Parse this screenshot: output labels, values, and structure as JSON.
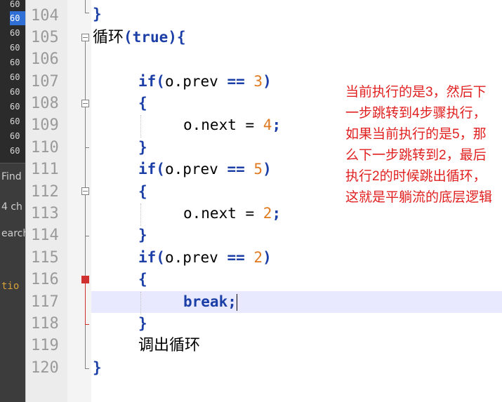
{
  "sidebar": {
    "numbers": [
      "60",
      "60",
      "60",
      "60",
      "60",
      "60",
      "60",
      "60",
      "60",
      "60",
      "60"
    ],
    "find_label": "Find",
    "count_label": "4 ch",
    "search_label": "earch",
    "output_label": "tio"
  },
  "editor": {
    "lines": [
      {
        "no": "104",
        "text": "}"
      },
      {
        "no": "105",
        "text": "循环(true){"
      },
      {
        "no": "106",
        "text": ""
      },
      {
        "no": "107",
        "text": "if(o.prev == 3)"
      },
      {
        "no": "108",
        "text": "{"
      },
      {
        "no": "109",
        "text": "o.next = 4;"
      },
      {
        "no": "110",
        "text": "}"
      },
      {
        "no": "111",
        "text": "if(o.prev == 5)"
      },
      {
        "no": "112",
        "text": "{"
      },
      {
        "no": "113",
        "text": "o.next = 2;"
      },
      {
        "no": "114",
        "text": "}"
      },
      {
        "no": "115",
        "text": "if(o.prev == 2)"
      },
      {
        "no": "116",
        "text": "{"
      },
      {
        "no": "117",
        "text": "break;"
      },
      {
        "no": "118",
        "text": "}"
      },
      {
        "no": "119",
        "text": "调出循环"
      },
      {
        "no": "120",
        "text": "}"
      }
    ],
    "tokens": {
      "loop_kw": "循环",
      "true_kw": "(true)",
      "brace_open": "{",
      "brace_close": "}",
      "if_kw": "if",
      "cond_a": "(o.prev ",
      "eq": "==",
      "three": "3",
      "five": "5",
      "two": "2",
      "paren_close": ")",
      "next_a": "o.next = ",
      "four": "4",
      "semi": ";",
      "break_kw": "break",
      "exit_text": "调出循环"
    }
  },
  "annotation": {
    "text": "当前执行的是3，然后下一步跳转到4步骤执行，如果当前执行的是5，那么下一步跳转到2，最后执行2的时候跳出循环，这就是平躺流的底层逻辑",
    "color": "#e02020"
  },
  "colors": {
    "keyword": "#1b3fa6",
    "number": "#e07a20",
    "line_highlight": "#e8e8ff",
    "sidebar_selected": "#2f6fd6"
  }
}
